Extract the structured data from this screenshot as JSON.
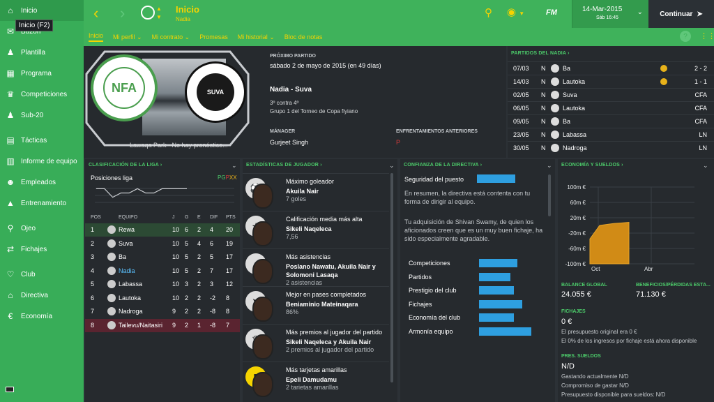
{
  "sidebar": {
    "tooltip": "Inicio (F2)",
    "items": [
      {
        "label": "Inicio",
        "icon": "home-icon"
      },
      {
        "label": "Buzón",
        "icon": "inbox-icon"
      },
      {
        "label": "Plantilla",
        "icon": "squad-icon"
      },
      {
        "label": "Programa",
        "icon": "schedule-icon"
      },
      {
        "label": "Competiciones",
        "icon": "trophy-icon"
      },
      {
        "label": "Sub-20",
        "icon": "youth-icon"
      },
      {
        "label": "Tácticas",
        "icon": "tactics-icon"
      },
      {
        "label": "Informe de equipo",
        "icon": "report-icon"
      },
      {
        "label": "Empleados",
        "icon": "staff-icon"
      },
      {
        "label": "Entrenamiento",
        "icon": "training-icon"
      },
      {
        "label": "Ojeo",
        "icon": "scouting-icon"
      },
      {
        "label": "Fichajes",
        "icon": "transfers-icon"
      },
      {
        "label": "Club",
        "icon": "club-icon"
      },
      {
        "label": "Directiva",
        "icon": "board-icon"
      },
      {
        "label": "Economía",
        "icon": "finance-icon"
      }
    ]
  },
  "topbar": {
    "title": "Inicio",
    "subtitle": "Nadia",
    "fm_logo": "FM",
    "date": "14-Mar-2015",
    "time": "Sáb 16:45",
    "continue": "Continuar"
  },
  "subnav": {
    "items": [
      "Inicio",
      "Mi perfil",
      "Mi contrato",
      "Promesas",
      "Mi historial",
      "Bloc de notas"
    ],
    "help": "?"
  },
  "next_match": {
    "label": "PRÓXIMO PARTIDO",
    "date": "sábado 2 de mayo de 2015 (en 49 días)",
    "teams": "Nadia - Suva",
    "position": "3º contra 4º",
    "competition": "Grupo 1 del Torneo de Copa fiyiano",
    "venue": "Lawaqa Park · No hay pronóstico...",
    "manager_label": "MÁNAGER",
    "manager": "Gurjeet Singh",
    "previous_label": "ENFRENTAMIENTOS ANTERIORES",
    "previous": "P",
    "home_badge_text": "NFA",
    "away_badge_text": "SUVA"
  },
  "fixtures": {
    "title": "PARTIDOS DEL NADIA",
    "rows": [
      {
        "date": "07/03",
        "venue": "N",
        "opp": "Ba",
        "result": "2 - 2",
        "icon": true
      },
      {
        "date": "14/03",
        "venue": "N",
        "opp": "Lautoka",
        "result": "1 - 1",
        "icon": true
      },
      {
        "date": "02/05",
        "venue": "N",
        "opp": "Suva",
        "result": "CFA",
        "icon": false
      },
      {
        "date": "06/05",
        "venue": "N",
        "opp": "Lautoka",
        "result": "CFA",
        "icon": false
      },
      {
        "date": "09/05",
        "venue": "N",
        "opp": "Ba",
        "result": "CFA",
        "icon": false
      },
      {
        "date": "23/05",
        "venue": "N",
        "opp": "Labassa",
        "result": "LN",
        "icon": false
      },
      {
        "date": "30/05",
        "venue": "N",
        "opp": "Nadroga",
        "result": "LN",
        "icon": false
      }
    ]
  },
  "league": {
    "title": "CLASIFICACIÓN DE LA LIGA",
    "subtitle": "Posiciones liga",
    "legend": {
      "pg": "PG",
      "px": "P",
      "xx": "XX"
    },
    "trend": [
      3,
      3,
      5,
      4,
      4,
      3,
      4,
      4,
      3,
      3,
      3,
      3
    ],
    "headers": [
      "POS",
      "EQUIPO",
      "J",
      "G",
      "E",
      "DIF",
      "PTS"
    ],
    "rows": [
      {
        "pos": "1",
        "team": "Rewa",
        "j": "10",
        "g": "6",
        "e": "2",
        "dif": "4",
        "pts": "20"
      },
      {
        "pos": "2",
        "team": "Suva",
        "j": "10",
        "g": "5",
        "e": "4",
        "dif": "6",
        "pts": "19"
      },
      {
        "pos": "3",
        "team": "Ba",
        "j": "10",
        "g": "5",
        "e": "2",
        "dif": "5",
        "pts": "17"
      },
      {
        "pos": "4",
        "team": "Nadia",
        "j": "10",
        "g": "5",
        "e": "2",
        "dif": "7",
        "pts": "17"
      },
      {
        "pos": "5",
        "team": "Labassa",
        "j": "10",
        "g": "3",
        "e": "2",
        "dif": "3",
        "pts": "12"
      },
      {
        "pos": "6",
        "team": "Lautoka",
        "j": "10",
        "g": "2",
        "e": "2",
        "dif": "-2",
        "pts": "8"
      },
      {
        "pos": "7",
        "team": "Nadroga",
        "j": "9",
        "g": "2",
        "e": "2",
        "dif": "-8",
        "pts": "8"
      },
      {
        "pos": "8",
        "team": "Tailevu/Naitasiri",
        "j": "9",
        "g": "2",
        "e": "1",
        "dif": "-8",
        "pts": "7"
      }
    ]
  },
  "player_stats": {
    "title": "ESTADÍSTICAS DE JUGADOR",
    "items": [
      {
        "label": "Máximo goleador",
        "name": "Akuila Nair",
        "value": "7 goles",
        "icon": "ball-icon"
      },
      {
        "label": "Calificación media más alta",
        "name": "Sikeli Naqeleca",
        "value": "7,56",
        "icon": "star-icon"
      },
      {
        "label": "Más asistencias",
        "name": "Poslano Nawatu, Akuila Nair y Solomoni Lasaqa",
        "value": "2 asistencias",
        "icon": "assist-icon"
      },
      {
        "label": "Mejor en pases completados",
        "name": "Beniaminio Mateinaqara",
        "value": "86%",
        "icon": "pass-icon"
      },
      {
        "label": "Más premios al jugador del partido",
        "name": "Sikeli Naqeleca y Akuila Nair",
        "value": "2 premios al jugador del partido",
        "icon": "award-icon"
      },
      {
        "label": "Más tarjetas amarillas",
        "name": "Epeli Damudamu",
        "value": "2 tarietas amarillas",
        "icon": "yellow-card-icon"
      }
    ]
  },
  "board": {
    "title": "CONFIANZA DE LA DIRECTIVA",
    "job_security": "Seguridad del puesto",
    "job_security_level": 0.5,
    "text1": "En resumen, la directiva está contenta con tu forma de dirigir al equipo.",
    "text2": "Tu adquisición de Shivan Swamy, de quien los aficionados creen que es un muy buen fichaje, ha sido especialmente agradable.",
    "rows": [
      {
        "label": "Competiciones",
        "level": 0.55
      },
      {
        "label": "Partidos",
        "level": 0.45
      },
      {
        "label": "Prestigio del club",
        "level": 0.5
      },
      {
        "label": "Fichajes",
        "level": 0.62
      },
      {
        "label": "Economía del club",
        "level": 0.5
      },
      {
        "label": "Armonía equipo",
        "level": 0.75
      }
    ]
  },
  "finance": {
    "title": "ECONOMÍA Y SUELDOS",
    "chart_data": {
      "type": "area",
      "x": [
        "Oct",
        "Abr"
      ],
      "yticks": [
        "100m €",
        "80m €",
        "60m €",
        "40m €",
        "20m €",
        "0m €",
        "-20m €",
        "-40m €",
        "-60m €",
        "-80m €",
        "-100m €"
      ],
      "ylim": [
        -100,
        100
      ],
      "series": [
        {
          "values": [
            -35,
            0,
            5,
            8
          ]
        }
      ]
    },
    "balance_label": "BALANCE GLOBAL",
    "balance": "24.055 €",
    "profit_label": "BENEFICIOS/PÉRDIDAS ESTA...",
    "profit": "71.130 €",
    "transfers_label": "FICHAJES",
    "transfers": "0 €",
    "transfers_note1": "El presupuesto original era 0 €",
    "transfers_note2": "El 0% de los ingresos por fichaje está ahora disponible",
    "wages_label": "PRES. SUELDOS",
    "wages": "N/D",
    "wages_note1": "Gastando actualmente N/D",
    "wages_note2": "Compromiso de gastar N/D",
    "wages_note3": "Presupuesto disponible para sueldos: N/D"
  },
  "colors": {
    "accent": "#f5d300",
    "green": "#3fb25b",
    "bar": "#2e9fe0"
  }
}
